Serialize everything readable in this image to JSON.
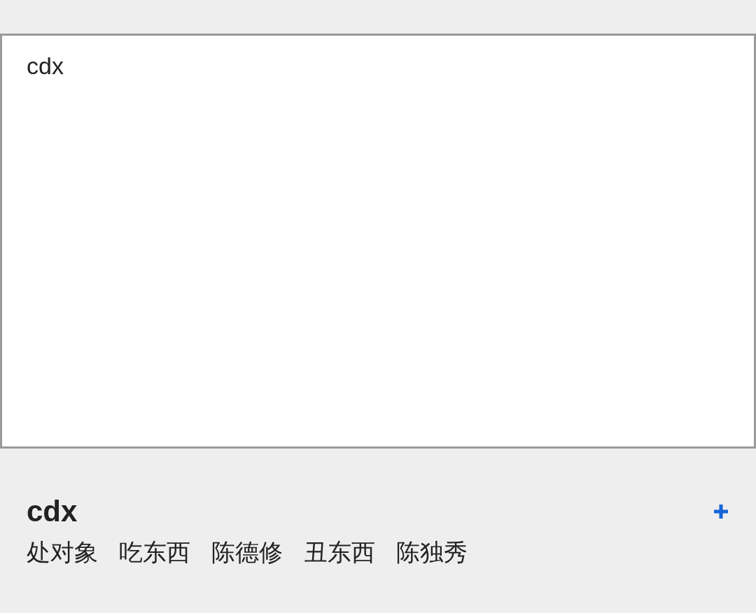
{
  "input": {
    "value": "cdx"
  },
  "suggestion": {
    "title": "cdx",
    "candidates": [
      {
        "text": "处对象"
      },
      {
        "text": "吃东西"
      },
      {
        "text": "陈德修"
      },
      {
        "text": "丑东西"
      },
      {
        "text": "陈独秀"
      }
    ]
  }
}
